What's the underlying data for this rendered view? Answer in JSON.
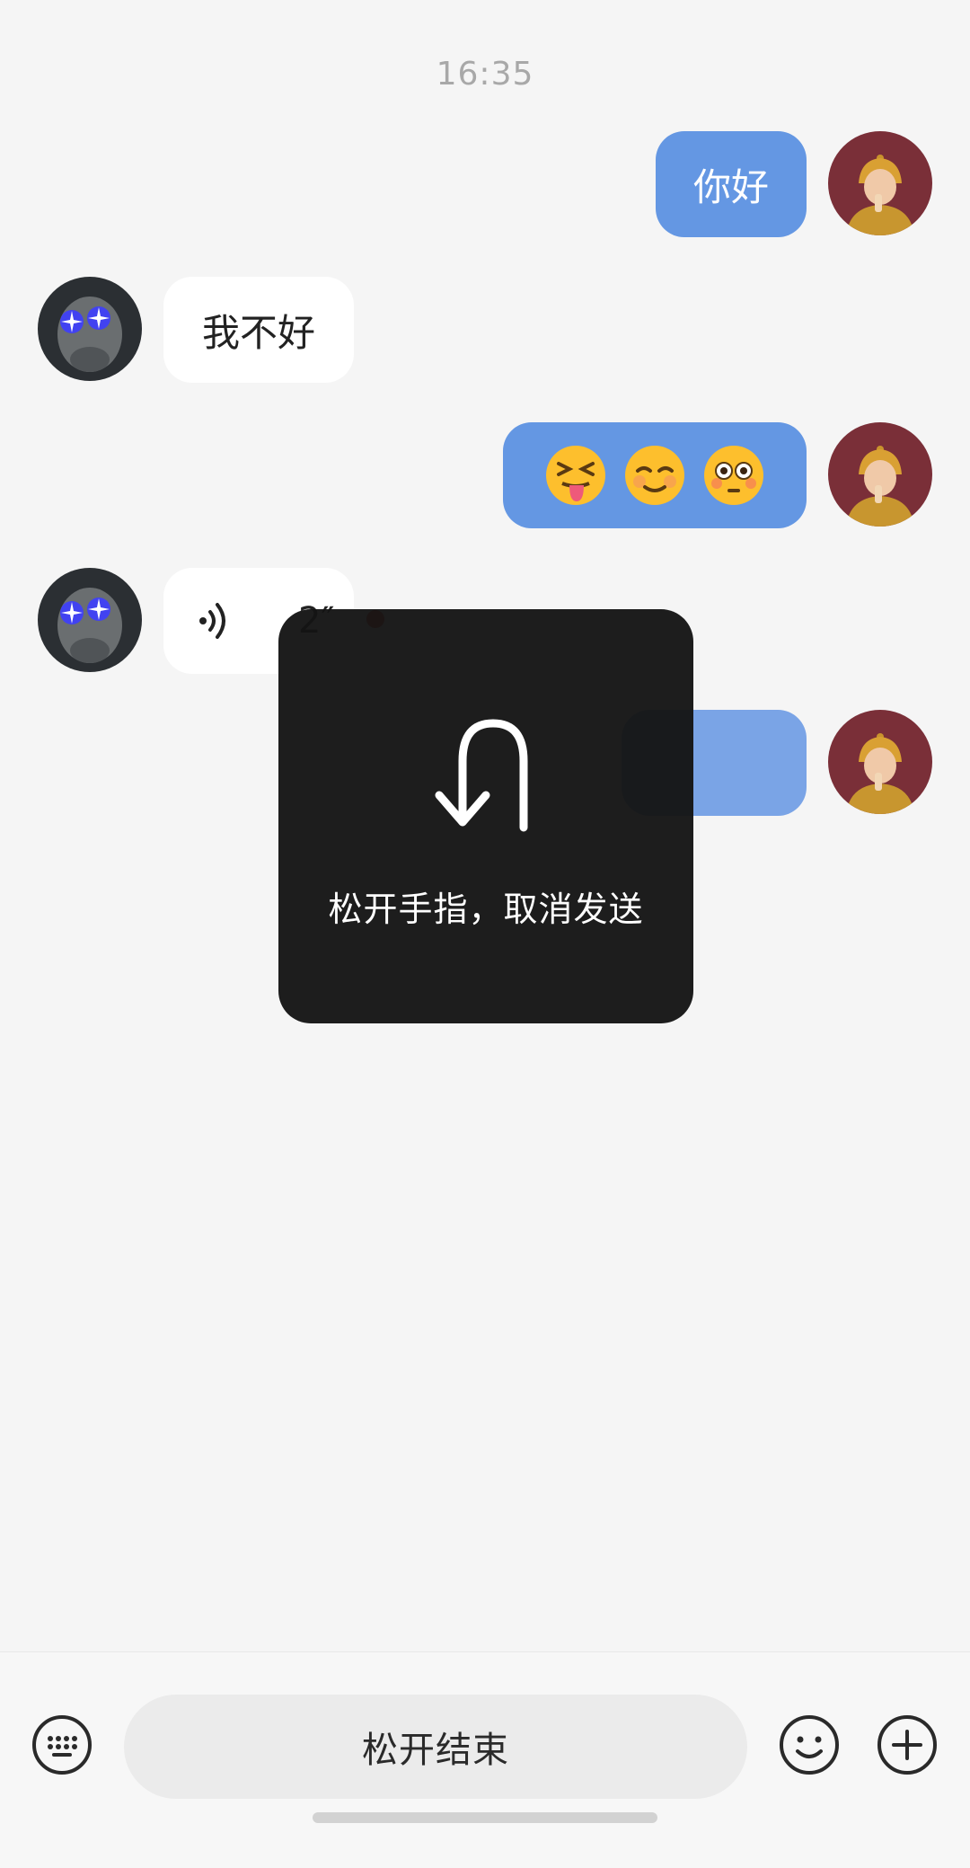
{
  "chat": {
    "timestamp": "16:35",
    "messages": [
      {
        "sender": "me",
        "type": "text",
        "text": "你好"
      },
      {
        "sender": "other",
        "type": "text",
        "text": "我不好"
      },
      {
        "sender": "me",
        "type": "emoji",
        "emojis": [
          "squinting-face-with-tongue-icon",
          "smiling-face-icon",
          "flushed-face-icon"
        ]
      },
      {
        "sender": "other",
        "type": "voice",
        "duration": "2″",
        "unread": true
      },
      {
        "sender": "me",
        "type": "recording"
      }
    ]
  },
  "overlay": {
    "icon": "u-turn-arrow-icon",
    "text": "松开手指，取消发送"
  },
  "input_bar": {
    "keyboard_icon": "keyboard-icon",
    "hold_label": "松开结束",
    "emoji_icon": "smiley-icon",
    "plus_icon": "plus-circle-icon"
  },
  "colors": {
    "background": "#f5f5f5",
    "my_bubble": "#6497e3",
    "their_bubble": "#ffffff",
    "overlay": "#141414",
    "unread_dot": "#d9342b"
  }
}
